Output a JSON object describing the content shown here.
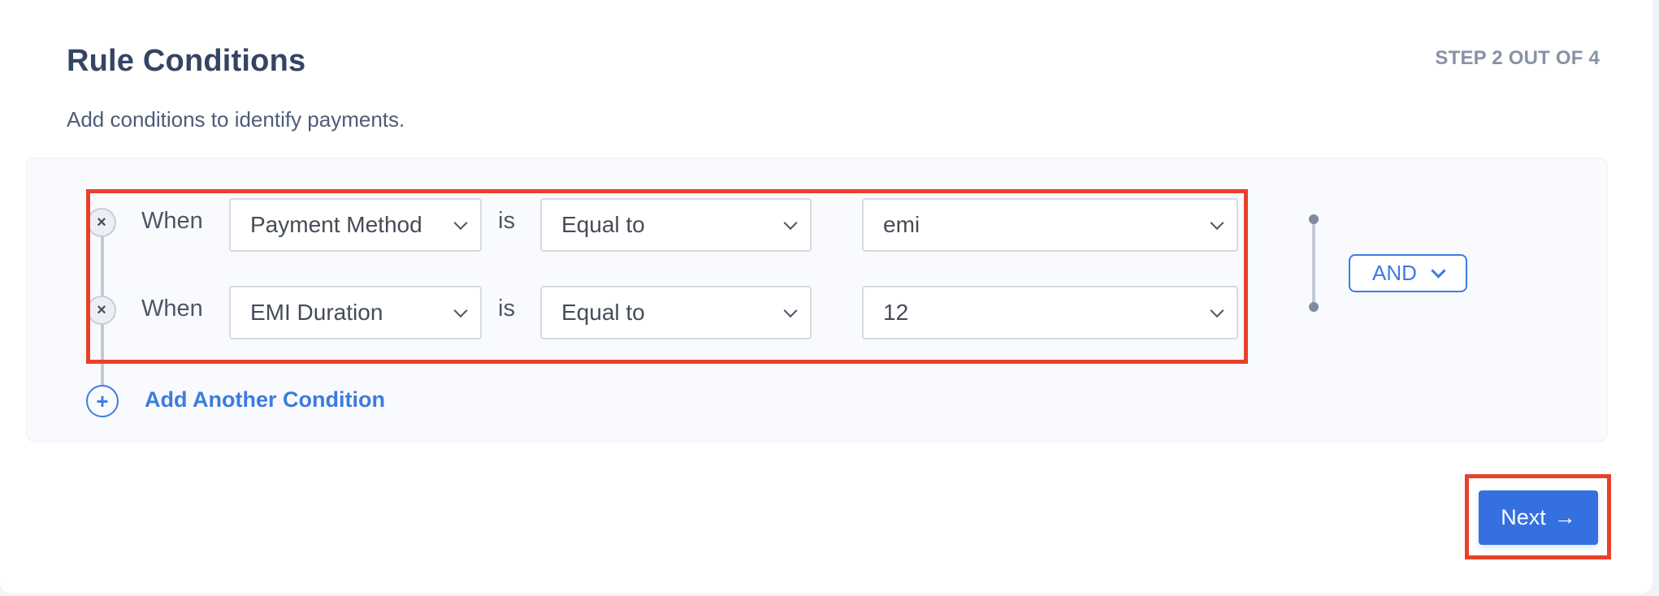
{
  "header": {
    "title": "Rule Conditions",
    "step_indicator": "STEP 2 OUT OF 4",
    "subtitle": "Add conditions to identify payments."
  },
  "conditions": [
    {
      "prefix": "When",
      "field": "Payment Method",
      "connector": "is",
      "operator": "Equal to",
      "value": "emi",
      "remove_icon": "close-icon"
    },
    {
      "prefix": "When",
      "field": "EMI Duration",
      "connector": "is",
      "operator": "Equal to",
      "value": "12",
      "remove_icon": "close-icon"
    }
  ],
  "add_condition": {
    "label": "Add Another Condition",
    "icon": "plus-circle-icon",
    "icon_glyph": "+"
  },
  "logic_operator": {
    "selected": "AND"
  },
  "footer": {
    "next_label": "Next",
    "next_icon": "arrow-right-icon",
    "next_glyph": "→"
  },
  "glyphs": {
    "close": "×"
  },
  "colors": {
    "accent": "#3d7be0",
    "primary_button": "#3470e0",
    "title": "#344563",
    "highlight": "#e8412a"
  }
}
